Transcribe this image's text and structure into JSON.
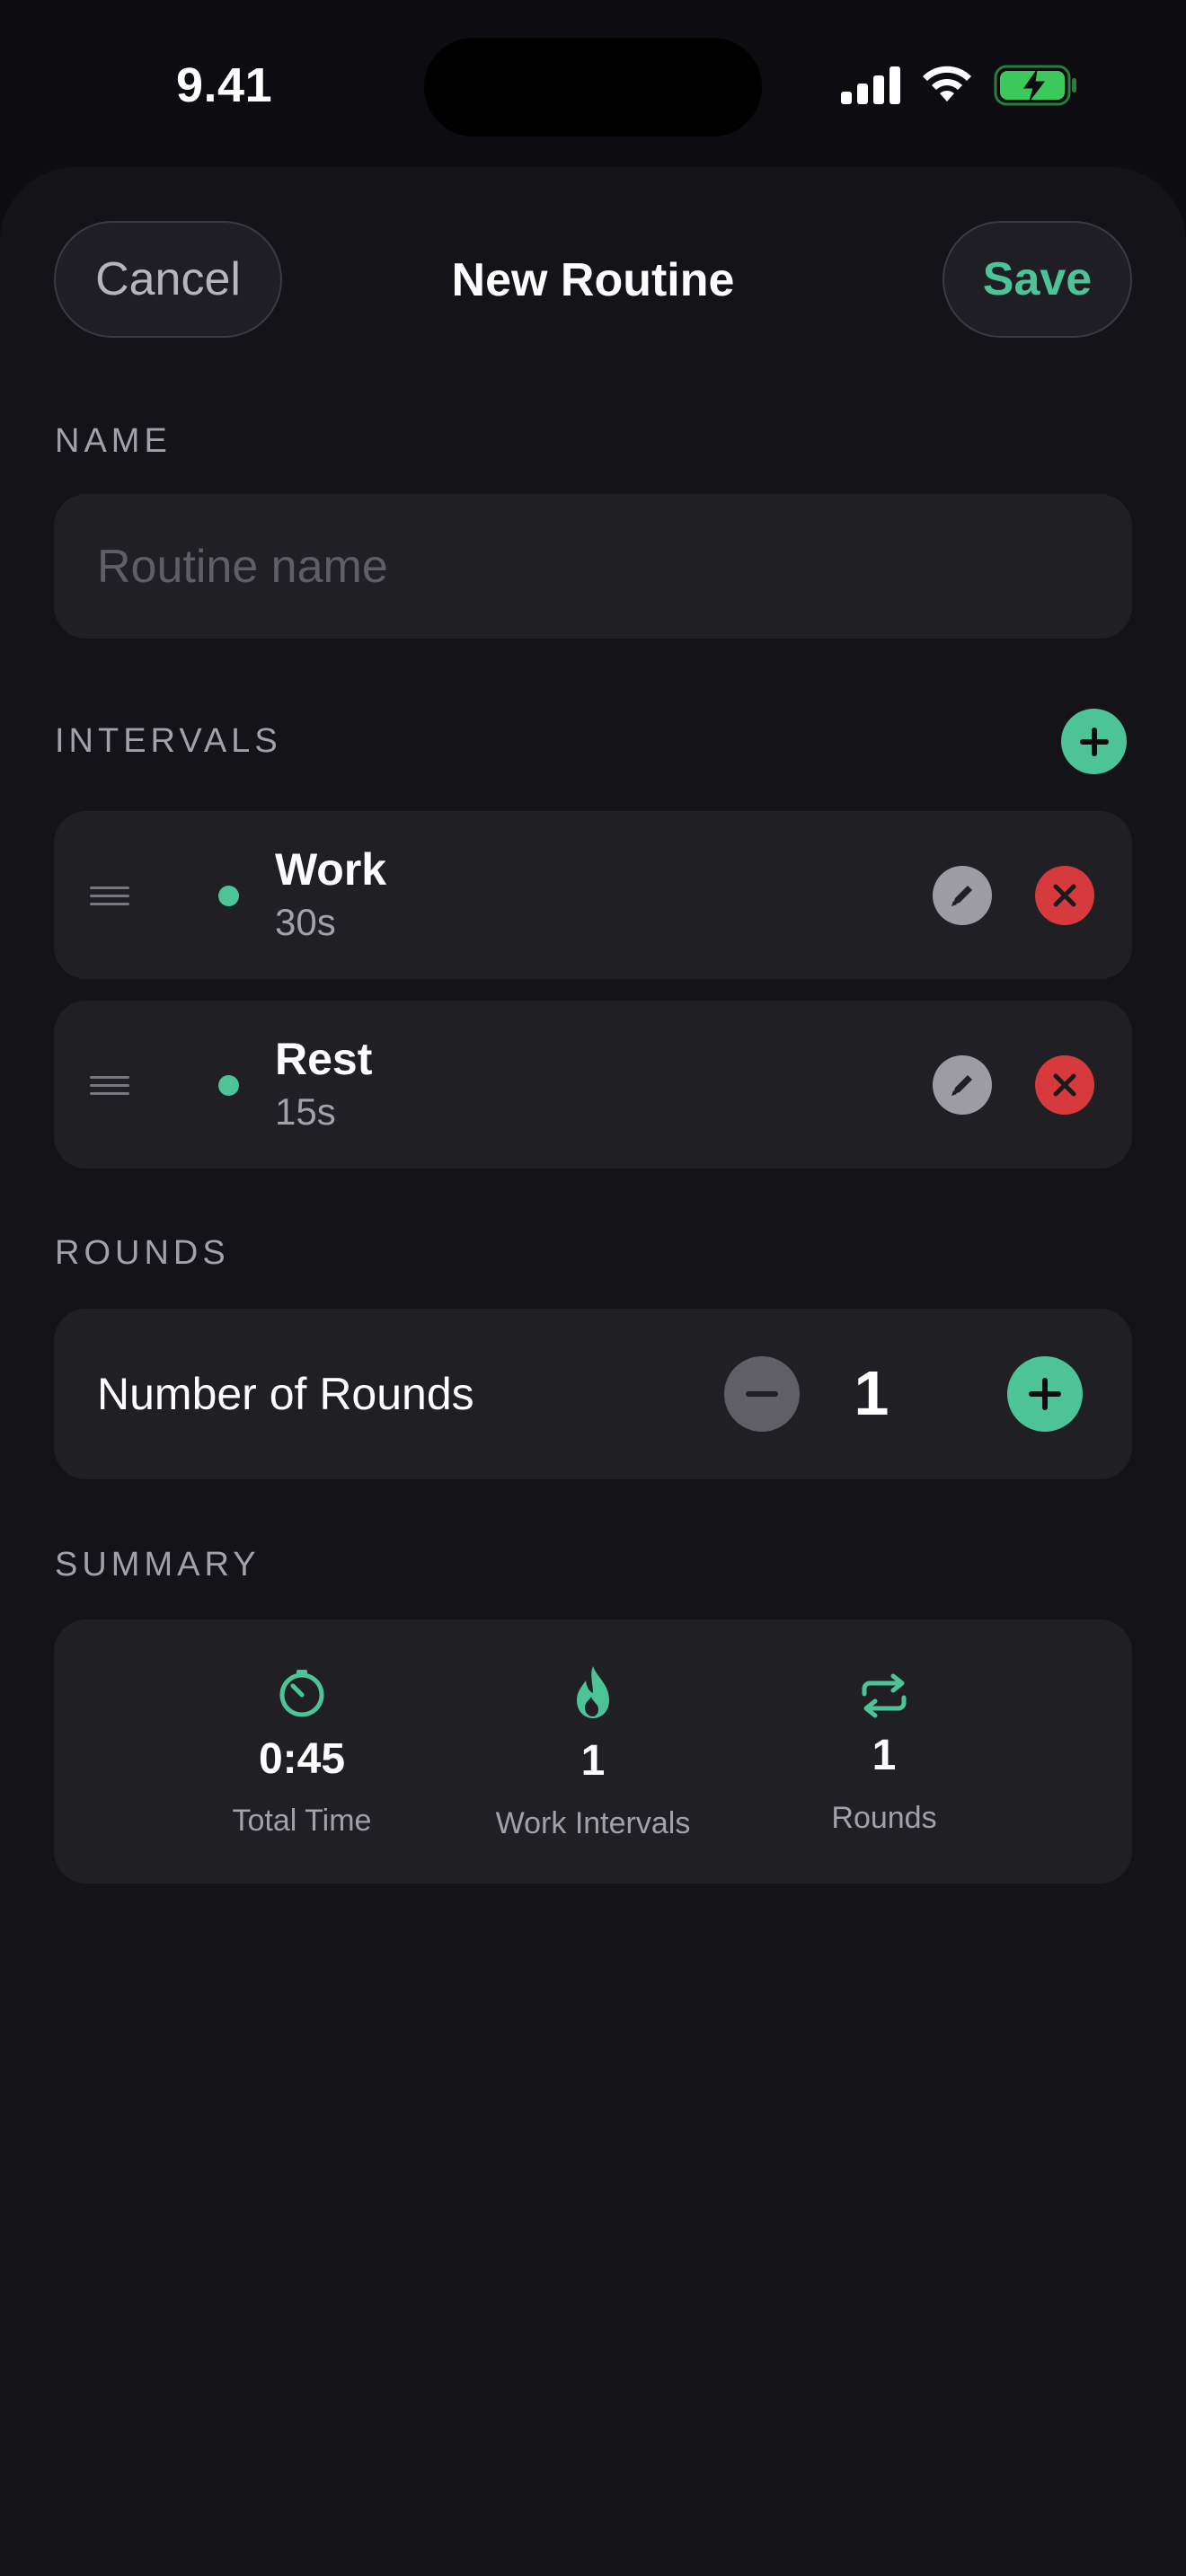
{
  "status_bar": {
    "time": "9.41",
    "icons": [
      "signal-icon",
      "wifi-icon",
      "battery-charging-icon"
    ],
    "battery_color": "#3cc85a"
  },
  "header": {
    "cancel_label": "Cancel",
    "title": "New Routine",
    "save_label": "Save"
  },
  "name_section": {
    "label": "NAME",
    "value": "",
    "placeholder": "Routine name"
  },
  "intervals_section": {
    "label": "INTERVALS",
    "add_icon": "plus-icon",
    "items": [
      {
        "name": "Work",
        "duration": "30s",
        "color": "#4cc497"
      },
      {
        "name": "Rest",
        "duration": "15s",
        "color": "#4cc497"
      }
    ]
  },
  "rounds_section": {
    "label": "ROUNDS",
    "row_label": "Number of Rounds",
    "value": "1"
  },
  "summary_section": {
    "label": "SUMMARY",
    "items": [
      {
        "icon": "timer-icon",
        "value": "0:45",
        "label": "Total Time"
      },
      {
        "icon": "flame-icon",
        "value": "1",
        "label": "Work Intervals"
      },
      {
        "icon": "repeat-icon",
        "value": "1",
        "label": "Rounds"
      }
    ]
  },
  "colors": {
    "accent": "#4cc497",
    "destructive": "#d63a3d",
    "background": "#131318",
    "card": "#1f1f24"
  }
}
